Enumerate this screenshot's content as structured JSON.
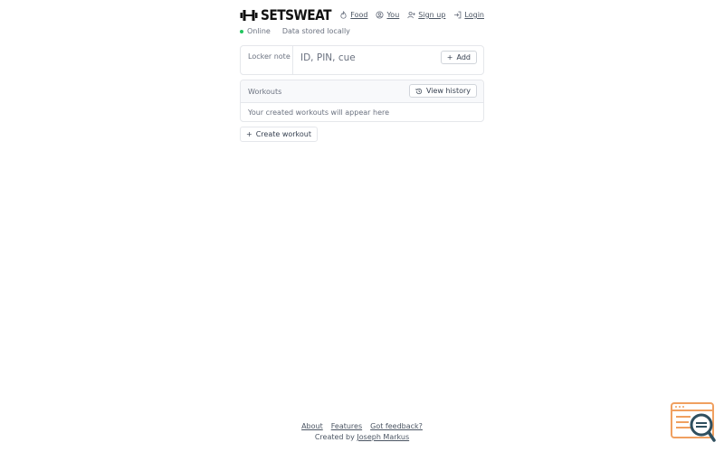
{
  "app": {
    "name": "SETSWEAT",
    "logo_icon": "dumbbell-icon"
  },
  "nav": {
    "items": [
      {
        "label": "Food",
        "icon": "flame-icon"
      },
      {
        "label": "You",
        "icon": "user-circle-icon"
      },
      {
        "label": "Sign up",
        "icon": "user-plus-icon"
      },
      {
        "label": "Login",
        "icon": "login-icon"
      }
    ]
  },
  "status": {
    "online": "Online",
    "storage": "Data stored locally",
    "online_color": "#22c55e"
  },
  "locker": {
    "label": "Locker note",
    "placeholder": "ID, PIN, cue",
    "value": "",
    "add_label": "Add",
    "add_icon": "plus-icon"
  },
  "workouts": {
    "title": "Workouts",
    "history_label": "View history",
    "history_icon": "history-icon",
    "empty_text": "Your created workouts will appear here"
  },
  "create": {
    "label": "Create workout",
    "icon": "plus-icon"
  },
  "footer": {
    "links": [
      "About",
      "Features",
      "Got feedback?"
    ],
    "credit_prefix": "Created by",
    "credit_name": "Joseph Markus"
  },
  "corner_widget": {
    "icon": "search-page-icon",
    "accent_color": "#f0a060"
  }
}
